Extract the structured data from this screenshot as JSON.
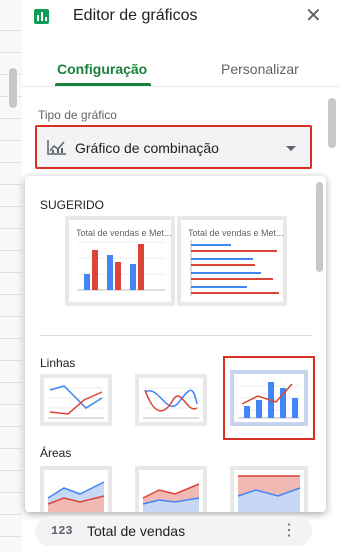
{
  "editor": {
    "title": "Editor de gráficos",
    "close_icon": "close-icon",
    "tabs": [
      {
        "label": "Configuração",
        "active": true
      },
      {
        "label": "Personalizar",
        "active": false
      }
    ],
    "chart_type_label": "Tipo de gráfico",
    "chart_type_value": "Gráfico de combinação",
    "accent_color": "#188038",
    "highlight_color": "#d93025"
  },
  "dropdown": {
    "suggested_heading": "SUGERIDO",
    "suggested_titles": [
      "Total de vendas e Met...",
      "Total de vendas e Met..."
    ],
    "lines_heading": "Linhas",
    "areas_heading": "Áreas"
  },
  "footer": {
    "icon_text": "123",
    "label": "Total de vendas",
    "menu_icon": "more-vert-icon"
  }
}
